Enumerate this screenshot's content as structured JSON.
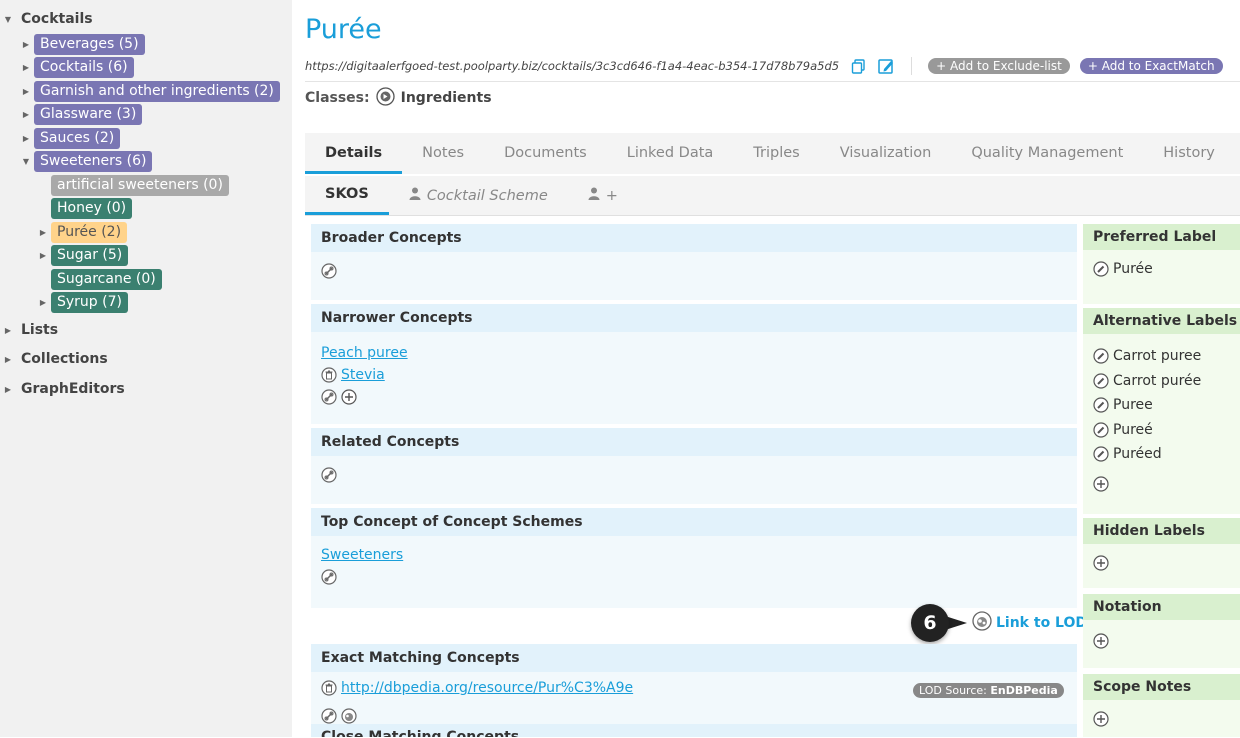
{
  "sidebar": {
    "root": "Cocktails",
    "children": [
      {
        "label": "Beverages (5)",
        "color": "purple"
      },
      {
        "label": "Cocktails (6)",
        "color": "purple"
      },
      {
        "label": "Garnish and other ingredients (2)",
        "color": "purple"
      },
      {
        "label": "Glassware (3)",
        "color": "purple"
      },
      {
        "label": "Sauces (2)",
        "color": "purple"
      },
      {
        "label": "Sweeteners (6)",
        "color": "purple"
      }
    ],
    "sweeteners_children": [
      {
        "label": "artificial sweeteners (0)",
        "color": "grey"
      },
      {
        "label": "Honey (0)",
        "color": "green"
      },
      {
        "label": "Purée (2)",
        "color": "orange"
      },
      {
        "label": "Sugar (5)",
        "color": "green"
      },
      {
        "label": "Sugarcane (0)",
        "color": "green"
      },
      {
        "label": "Syrup (7)",
        "color": "green"
      }
    ],
    "other_roots": [
      "Lists",
      "Collections",
      "GraphEditors"
    ]
  },
  "concept": {
    "title": "Purée",
    "uri": "https://digitaalerfgoed-test.poolparty.biz/cocktails/3c3cd646-f1a4-4eac-b354-17d78b79a5d5",
    "add_exclude": "+ Add to Exclude-list",
    "add_exactmatch": "+ Add to ExactMatch",
    "classes_label": "Classes:",
    "class_value": "Ingredients"
  },
  "tabs": [
    "Details",
    "Notes",
    "Documents",
    "Linked Data",
    "Triples",
    "Visualization",
    "Quality Management",
    "History"
  ],
  "subtabs": {
    "skos": "SKOS",
    "scheme": "Cocktail Scheme",
    "plus": "+"
  },
  "panels": {
    "broader": "Broader Concepts",
    "narrower": "Narrower Concepts",
    "narrower_items": [
      "Peach puree",
      "Stevia"
    ],
    "related": "Related Concepts",
    "top_concept": "Top Concept of Concept Schemes",
    "top_concept_item": "Sweeteners",
    "link_lod": "Link to LOD",
    "exact": "Exact Matching Concepts",
    "exact_item": "http://dbpedia.org/resource/Pur%C3%A9e",
    "lod_source_label": "LOD Source:",
    "lod_source_value": "EnDBPedia",
    "close": "Close Matching Concepts"
  },
  "right": {
    "preferred": "Preferred Label",
    "preferred_value": "Purée",
    "alternative": "Alternative Labels",
    "alternative_values": [
      "Carrot puree",
      "Carrot purée",
      "Puree",
      "Pureé",
      "Puréed"
    ],
    "hidden": "Hidden Labels",
    "notation": "Notation",
    "scope": "Scope Notes"
  },
  "callout": "6"
}
